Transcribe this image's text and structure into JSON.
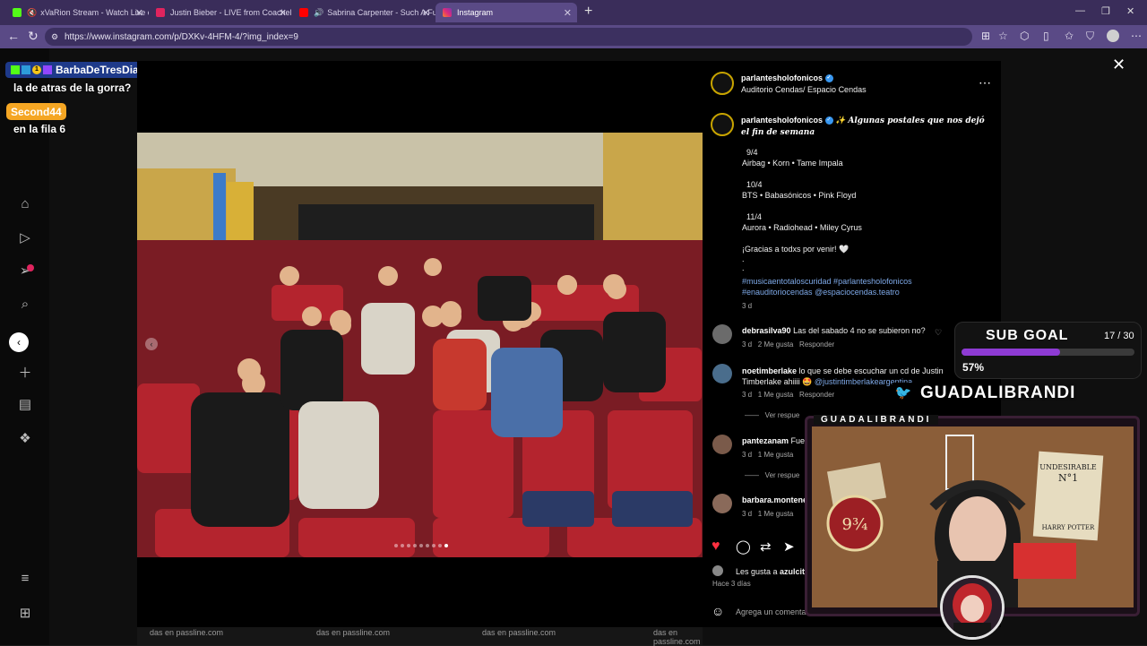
{
  "browser": {
    "tabs": [
      {
        "label": "xVaRion Stream - Watch Live o...",
        "fav_color": "#53fc18",
        "icon": "kick-icon",
        "extra_icon": "speaker-muted-icon",
        "active": false
      },
      {
        "label": "Justin Bieber - LIVE from Coachella",
        "fav_color": "#e0245e",
        "icon": "youtube-icon",
        "active": false
      },
      {
        "label": "Sabrina Carpenter - Such A Fu...",
        "fav_color": "#ff0000",
        "icon": "youtube-icon",
        "extra_icon": "speaker-icon",
        "active": false
      },
      {
        "label": "Instagram",
        "fav_color": "#e1306c",
        "icon": "instagram-icon",
        "active": true
      }
    ],
    "url": "https://www.instagram.com/p/DXKv-4HFM-4/?img_index=9"
  },
  "stream_chat": [
    {
      "user": "BarbaDeTresDias",
      "message": "la de atras de la gorra?",
      "color": "#1e3a8a"
    },
    {
      "user": "Second44",
      "message": "en la fila 6",
      "color": "#f5a623"
    }
  ],
  "post": {
    "author": "parlantesholofonicos",
    "location": "Auditorio Cendas/ Espacio Cendas",
    "caption_headline": "✨ Algunas postales que nos dejó el fin de semana",
    "lineups": [
      {
        "date": "9/4",
        "bands": "Airbag • Korn • Tame Impala"
      },
      {
        "date": "10/4",
        "bands": "BTS • Babasónicos • Pink Floyd"
      },
      {
        "date": "11/4",
        "bands": "Aurora • Radiohead • Miley Cyrus"
      }
    ],
    "thanks": "¡Gracias a todxs por venir! 🤍",
    "dots": ".",
    "hashtags_line1": "#musicaentotaloscuridad #parlantesholofonicos",
    "hashtags_line2a": "#enauditoriocendas",
    "hashtags_line2b": "@espaciocendas.teatro",
    "age": "3 d",
    "carousel_total": 9,
    "carousel_index": 9
  },
  "comments": [
    {
      "user": "debrasilva90",
      "text": "Las del sabado 4 no se subieron no?",
      "meta_age": "3 d",
      "meta_likes": "2 Me gusta",
      "reply": "Responder"
    },
    {
      "user": "noetimberlake",
      "text": "lo que se debe escuchar un cd de Justin",
      "text2a": "Timberlake ahiiii 🤩 ",
      "text2b": "@justintimberlakearg",
      "text2c": "entina",
      "meta_age": "3 d",
      "meta_likes": "1 Me gusta",
      "reply": "Responder",
      "view_replies": "Ver respue"
    },
    {
      "user": "pantezanam",
      "text": "Fue",
      "meta_age": "3 d",
      "meta_likes": "1 Me gusta",
      "view_replies": "Ver respue"
    },
    {
      "user": "barbara.montene",
      "text": "",
      "meta_age": "3 d",
      "meta_likes": "1 Me gusta"
    }
  ],
  "likes_line_prefix": "Les gusta a ",
  "likes_line_user": "azulcit",
  "post_age_long": "Hace 3 días",
  "comment_placeholder": "Agrega un comentario...",
  "sub_goal": {
    "title": "SUB GOAL",
    "count": "17 / 30",
    "percent_label": "57%",
    "fraction": 0.57
  },
  "twitter_handle": "GUADALIBRANDI",
  "webcam_label": "GUADALIBRANDI",
  "ticker": [
    "das en passline.com",
    "das en passline.com",
    "das en passline.com",
    "das en passline.com"
  ]
}
